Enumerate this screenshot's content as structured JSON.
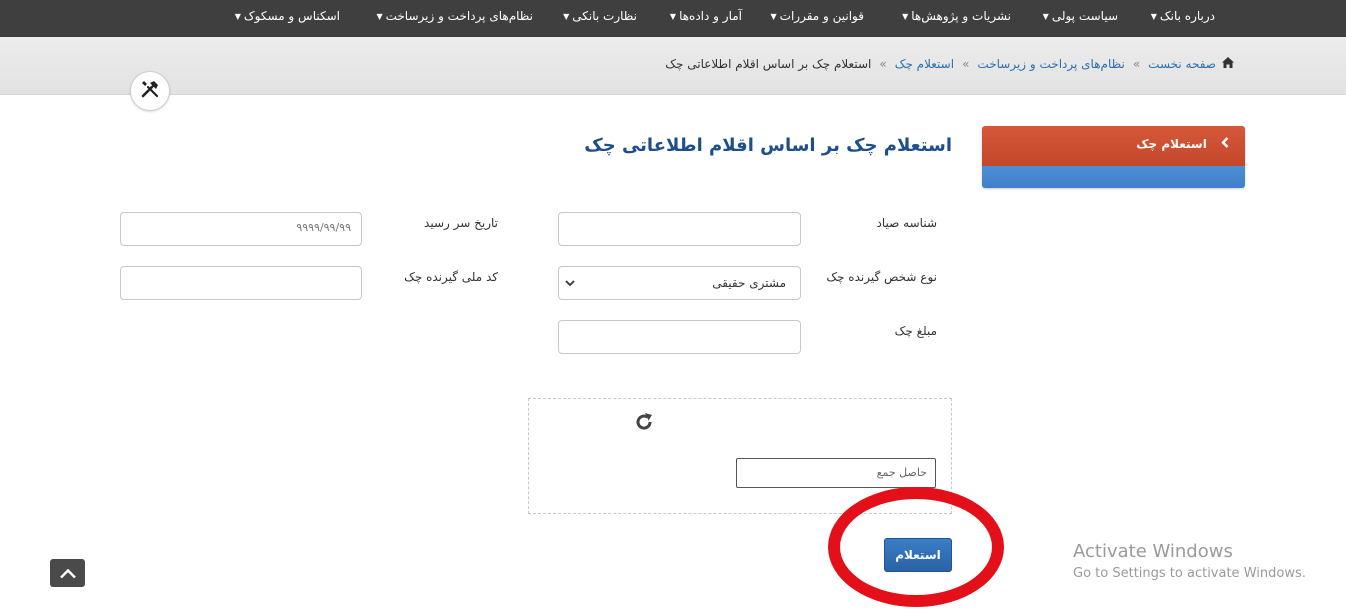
{
  "nav": {
    "items": [
      "درباره بانک",
      "سیاست پولی",
      "نشریات و پژوهش‌ها",
      "قوانین و مقررات",
      "آمار و داده‌ها",
      "نظارت بانکی",
      "نظام‌های پرداخت و زیرساخت",
      "اسکناس و مسکوک"
    ]
  },
  "breadcrumb": {
    "home": "صفحه نخست",
    "level2": "نظام‌های پرداخت و زیرساخت",
    "level3": "استعلام چک",
    "current": "استعلام چک بر اساس اقلام اطلاعاتی چک",
    "separator": "»"
  },
  "page": {
    "title": "استعلام چک بر اساس اقلام اطلاعاتی چک"
  },
  "sidebar": {
    "active_label": "استعلام چک"
  },
  "form": {
    "sayad_label": "شناسه صیاد",
    "sayad_value": "",
    "due_date_label": "تاریخ سر رسید",
    "due_date_placeholder": "۹۹۹۹/۹۹/۹۹",
    "receiver_type_label": "نوع شخص گیرنده چک",
    "receiver_type_value": "مشتری حقیقی",
    "national_code_label": "کد ملی گیرنده چک",
    "national_code_value": "",
    "amount_label": "مبلغ چک",
    "amount_value": ""
  },
  "captcha": {
    "placeholder": "حاصل جمع"
  },
  "submit": {
    "label": "استعلام"
  },
  "windows": {
    "activate_title": "Activate Windows",
    "activate_sub": "Go to Settings to activate Windows."
  },
  "colors": {
    "nav_bg": "#3f3f3f",
    "accent_orange": "#c4472b",
    "accent_blue": "#2a62a5",
    "title_blue": "#1f4f8a",
    "annotation_red": "#e3101a"
  },
  "icons": {
    "home": "home-icon",
    "tools": "tools-icon",
    "refresh": "refresh-icon",
    "chevron": "chevron-left-icon",
    "scroll_top": "chevron-up-icon",
    "caret": "caret-down-icon"
  }
}
